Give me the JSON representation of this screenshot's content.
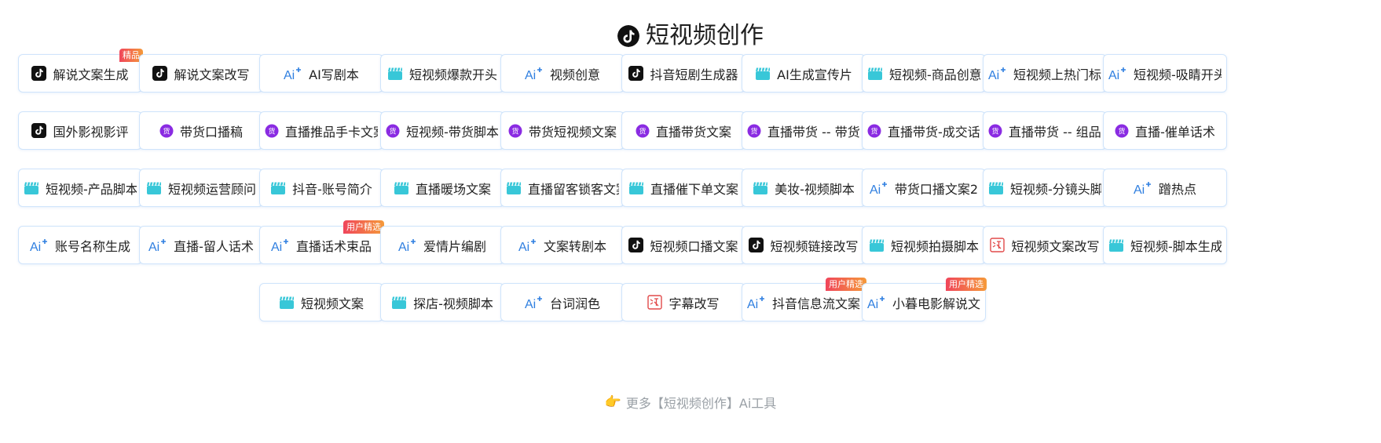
{
  "header": {
    "title": "短视频创作",
    "logo_icon": "tiktok-icon"
  },
  "colors": {
    "tiktok": "#111111",
    "ai": "#2f7fe0",
    "clapper": "#38c7d8",
    "goods": "#8a2be2",
    "subtitle": "#e24a4a",
    "badge_start": "#f0455b",
    "badge_end": "#f59a3a"
  },
  "rows": [
    [
      {
        "label": "解说文案生成",
        "icon": "tiktok",
        "badge": "精品"
      },
      {
        "label": "解说文案改写",
        "icon": "tiktok"
      },
      {
        "label": "AI写剧本",
        "icon": "ai"
      },
      {
        "label": "短视频爆款开头",
        "icon": "clapper"
      },
      {
        "label": "视频创意",
        "icon": "ai"
      },
      {
        "label": "抖音短剧生成器",
        "icon": "tiktok"
      },
      {
        "label": "AI生成宣传片",
        "icon": "clapper"
      },
      {
        "label": "短视频-商品创意",
        "icon": "clapper"
      },
      {
        "label": "短视频上热门标题",
        "icon": "ai"
      },
      {
        "label": "短视频-吸睛开头",
        "icon": "ai"
      }
    ],
    [
      {
        "label": "国外影视影评",
        "icon": "tiktok"
      },
      {
        "label": "带货口播稿",
        "icon": "goods"
      },
      {
        "label": "直播推品手卡文案",
        "icon": "goods"
      },
      {
        "label": "短视频-带货脚本",
        "icon": "goods"
      },
      {
        "label": "带货短视频文案",
        "icon": "goods"
      },
      {
        "label": "直播带货文案",
        "icon": "goods"
      },
      {
        "label": "直播带货 -- 带货话术",
        "icon": "goods"
      },
      {
        "label": "直播带货-成交话术",
        "icon": "goods"
      },
      {
        "label": "直播带货 -- 组品话术",
        "icon": "goods"
      },
      {
        "label": "直播-催单话术",
        "icon": "goods"
      }
    ],
    [
      {
        "label": "短视频-产品脚本",
        "icon": "clapper"
      },
      {
        "label": "短视频运营顾问",
        "icon": "clapper"
      },
      {
        "label": "抖音-账号简介",
        "icon": "clapper"
      },
      {
        "label": "直播暖场文案",
        "icon": "clapper"
      },
      {
        "label": "直播留客锁客文案",
        "icon": "clapper"
      },
      {
        "label": "直播催下单文案",
        "icon": "clapper"
      },
      {
        "label": "美妆-视频脚本",
        "icon": "clapper"
      },
      {
        "label": "带货口播文案2",
        "icon": "ai"
      },
      {
        "label": "短视频-分镜头脚本",
        "icon": "clapper"
      },
      {
        "label": "蹭热点",
        "icon": "ai"
      }
    ],
    [
      {
        "label": "账号名称生成",
        "icon": "ai"
      },
      {
        "label": "直播-留人话术",
        "icon": "ai"
      },
      {
        "label": "直播话术束品",
        "icon": "ai",
        "badge": "用户精选"
      },
      {
        "label": "爱情片编剧",
        "icon": "ai"
      },
      {
        "label": "文案转剧本",
        "icon": "ai"
      },
      {
        "label": "短视频口播文案",
        "icon": "tiktok"
      },
      {
        "label": "短视频链接改写",
        "icon": "tiktok"
      },
      {
        "label": "短视频拍摄脚本",
        "icon": "clapper"
      },
      {
        "label": "短视频文案改写",
        "icon": "subtitle"
      },
      {
        "label": "短视频-脚本生成",
        "icon": "clapper"
      }
    ],
    [
      {
        "label": "短视频文案",
        "icon": "clapper"
      },
      {
        "label": "探店-视频脚本",
        "icon": "clapper"
      },
      {
        "label": "台词润色",
        "icon": "ai"
      },
      {
        "label": "字幕改写",
        "icon": "subtitle"
      },
      {
        "label": "抖音信息流文案模板",
        "icon": "ai",
        "badge": "用户精选"
      },
      {
        "label": "小暮电影解说文案",
        "icon": "ai",
        "badge": "用户精选"
      }
    ]
  ],
  "footer": {
    "hand_icon": "pointing-hand-icon",
    "hand_glyph": "👉",
    "more_text": "更多【短视频创作】Ai工具"
  }
}
